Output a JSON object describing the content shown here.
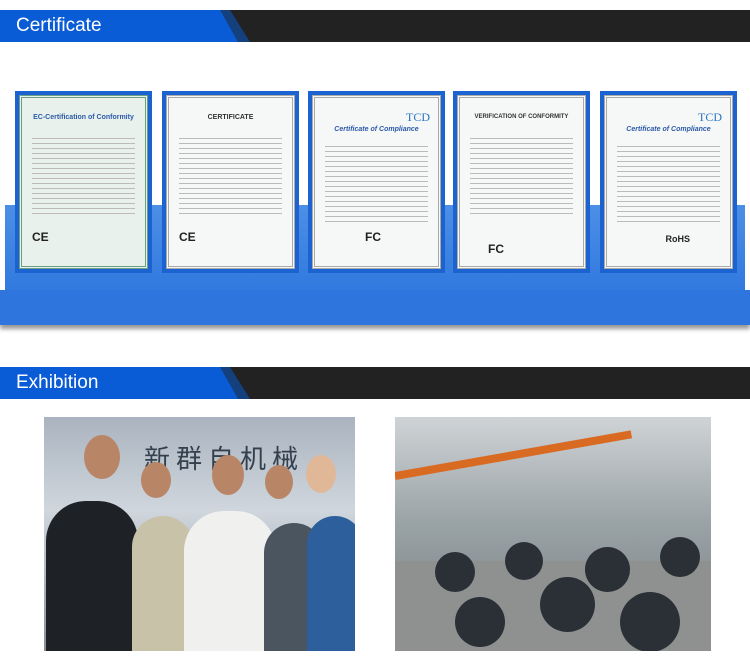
{
  "certificate_section": {
    "title": "Certificate",
    "certificates": [
      {
        "title": "EC-Certification of Conformity",
        "mark": "CE"
      },
      {
        "title": "CERTIFICATE",
        "mark": "CE"
      },
      {
        "title": "Certificate of Compliance",
        "brand": "TCD",
        "mark": "FC"
      },
      {
        "title": "VERIFICATION OF CONFORMITY",
        "mark": "FC"
      },
      {
        "title": "Certificate of Compliance",
        "brand": "TCD",
        "mark": "RoHS"
      }
    ]
  },
  "exhibition_section": {
    "title": "Exhibition",
    "sign_text": "新群自机械"
  },
  "colors": {
    "accent": "#0a5bd6",
    "bar": "#222222",
    "platform": "#2e76dd"
  }
}
